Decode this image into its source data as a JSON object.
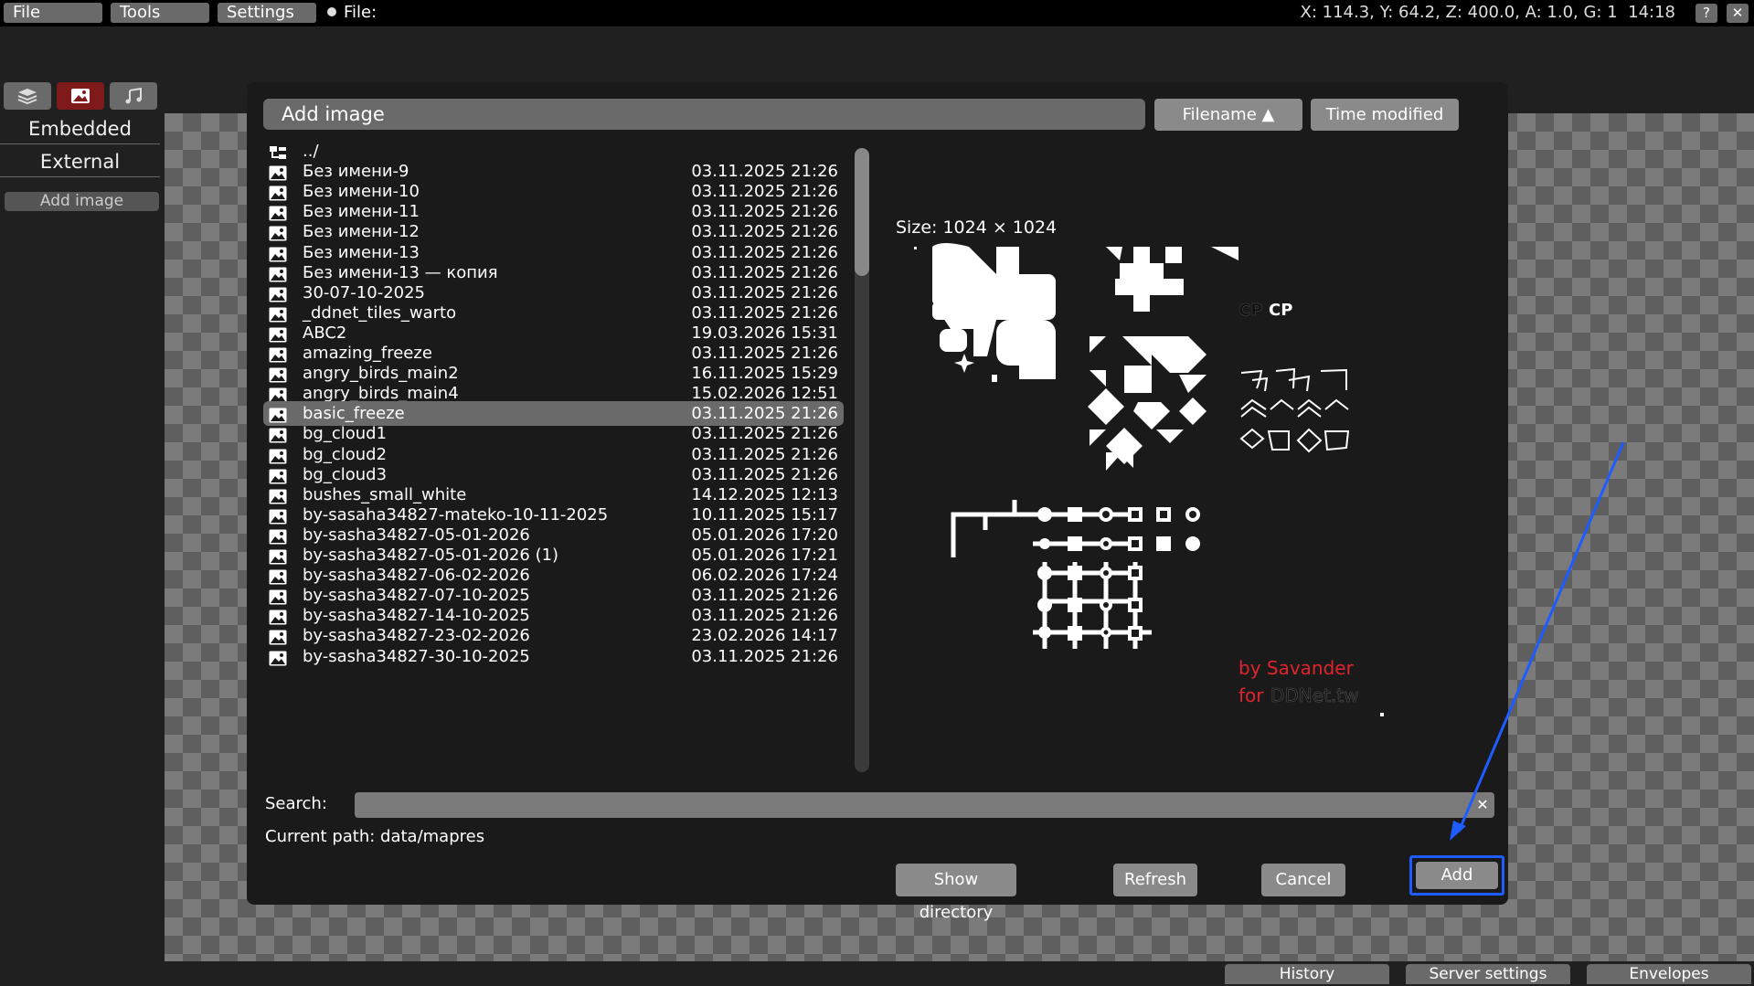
{
  "menu": {
    "file": "File",
    "tools": "Tools",
    "settings": "Settings",
    "file_label": "File:"
  },
  "status": {
    "coords": "X: 114.3, Y: 64.2, Z: 400.0, A: 1.0, G: 1",
    "time": "14:18",
    "help": "?",
    "close": "✕"
  },
  "left_panel": {
    "tabs": [
      "layers-icon",
      "image-icon",
      "music-icon"
    ],
    "active_tab": "image-icon",
    "embedded": "Embedded",
    "external": "External",
    "add_image": "Add image"
  },
  "bottom_tabs": {
    "history": "History",
    "server_settings": "Server settings",
    "envelopes": "Envelopes"
  },
  "dialog": {
    "title": "Add image",
    "sort_filename": "Filename ▲",
    "sort_time": "Time modified",
    "size": "Size: 1024 × 1024",
    "preview_credit_1": "by Savander",
    "preview_credit_2": "for",
    "preview_credit_3": "DDNet.tw",
    "preview_cp": "CP",
    "search_label": "Search:",
    "search_value": "",
    "current_path": "Current path: data/mapres",
    "show_directory": "Show directory",
    "refresh": "Refresh",
    "cancel": "Cancel",
    "add": "Add",
    "accent_color": "#1f5cff",
    "selected_index": 13,
    "files": [
      {
        "name": "../",
        "date": "",
        "icon": "folder-up-icon"
      },
      {
        "name": "Без имени-9",
        "date": "03.11.2025 21:26",
        "icon": "image-icon"
      },
      {
        "name": "Без имени-10",
        "date": "03.11.2025 21:26",
        "icon": "image-icon"
      },
      {
        "name": "Без имени-11",
        "date": "03.11.2025 21:26",
        "icon": "image-icon"
      },
      {
        "name": "Без имени-12",
        "date": "03.11.2025 21:26",
        "icon": "image-icon"
      },
      {
        "name": "Без имени-13",
        "date": "03.11.2025 21:26",
        "icon": "image-icon"
      },
      {
        "name": "Без имени-13 — копия",
        "date": "03.11.2025 21:26",
        "icon": "image-icon"
      },
      {
        "name": "30-07-10-2025",
        "date": "03.11.2025 21:26",
        "icon": "image-icon"
      },
      {
        "name": "_ddnet_tiles_warto",
        "date": "03.11.2025 21:26",
        "icon": "image-icon"
      },
      {
        "name": "ABC2",
        "date": "19.03.2026 15:31",
        "icon": "image-icon"
      },
      {
        "name": "amazing_freeze",
        "date": "03.11.2025 21:26",
        "icon": "image-icon"
      },
      {
        "name": "angry_birds_main2",
        "date": "16.11.2025 15:29",
        "icon": "image-icon"
      },
      {
        "name": "angry_birds_main4",
        "date": "15.02.2026 12:51",
        "icon": "image-icon"
      },
      {
        "name": "basic_freeze",
        "date": "03.11.2025 21:26",
        "icon": "image-icon"
      },
      {
        "name": "bg_cloud1",
        "date": "03.11.2025 21:26",
        "icon": "image-icon"
      },
      {
        "name": "bg_cloud2",
        "date": "03.11.2025 21:26",
        "icon": "image-icon"
      },
      {
        "name": "bg_cloud3",
        "date": "03.11.2025 21:26",
        "icon": "image-icon"
      },
      {
        "name": "bushes_small_white",
        "date": "14.12.2025 12:13",
        "icon": "image-icon"
      },
      {
        "name": "by-sasaha34827-mateko-10-11-2025",
        "date": "10.11.2025 15:17",
        "icon": "image-icon"
      },
      {
        "name": "by-sasha34827-05-01-2026",
        "date": "05.01.2026 17:20",
        "icon": "image-icon"
      },
      {
        "name": "by-sasha34827-05-01-2026 (1)",
        "date": "05.01.2026 17:21",
        "icon": "image-icon"
      },
      {
        "name": "by-sasha34827-06-02-2026",
        "date": "06.02.2026 17:24",
        "icon": "image-icon"
      },
      {
        "name": "by-sasha34827-07-10-2025",
        "date": "03.11.2025 21:26",
        "icon": "image-icon"
      },
      {
        "name": "by-sasha34827-14-10-2025",
        "date": "03.11.2025 21:26",
        "icon": "image-icon"
      },
      {
        "name": "by-sasha34827-23-02-2026",
        "date": "23.02.2026 14:17",
        "icon": "image-icon"
      },
      {
        "name": "by-sasha34827-30-10-2025",
        "date": "03.11.2025 21:26",
        "icon": "image-icon"
      }
    ]
  }
}
